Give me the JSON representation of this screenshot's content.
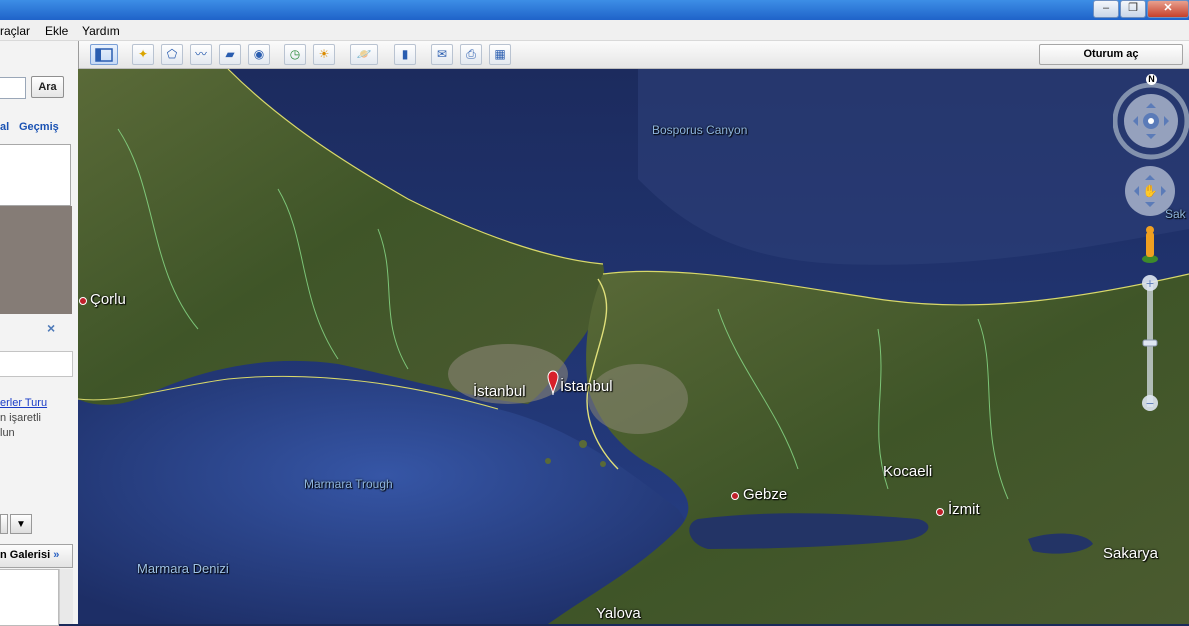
{
  "menu": {
    "items": [
      "raçlar",
      "Ekle",
      "Yardım"
    ]
  },
  "window_buttons": {
    "minimize": "–",
    "restore": "❐",
    "close": "✕"
  },
  "toolbar": {
    "signin_label": "Oturum aç"
  },
  "sidebar": {
    "search_button": "Ara",
    "tab_local": "al",
    "tab_history": "Geçmiş",
    "close_glyph": "×",
    "tour_link": "erler Turu",
    "tour_desc_line1": "n işaretli",
    "tour_desc_line2": "lun",
    "gallery_label": "n Galerisi",
    "gallery_chevron": "»"
  },
  "map": {
    "compass_north": "N",
    "labels": {
      "corlu": "Çorlu",
      "istanbul_1": "İstanbul",
      "istanbul_2": "İstanbul",
      "gebze": "Gebze",
      "kocaeli": "Kocaeli",
      "izmit": "İzmit",
      "sakarya": "Sakarya",
      "sakarya_partial": "Sak",
      "yalova": "Yalova",
      "bosporus_canyon": "Bosporus Canyon",
      "marmara_trough": "Marmara Trough",
      "marmara_denizi": "Marmara Denizi"
    }
  }
}
